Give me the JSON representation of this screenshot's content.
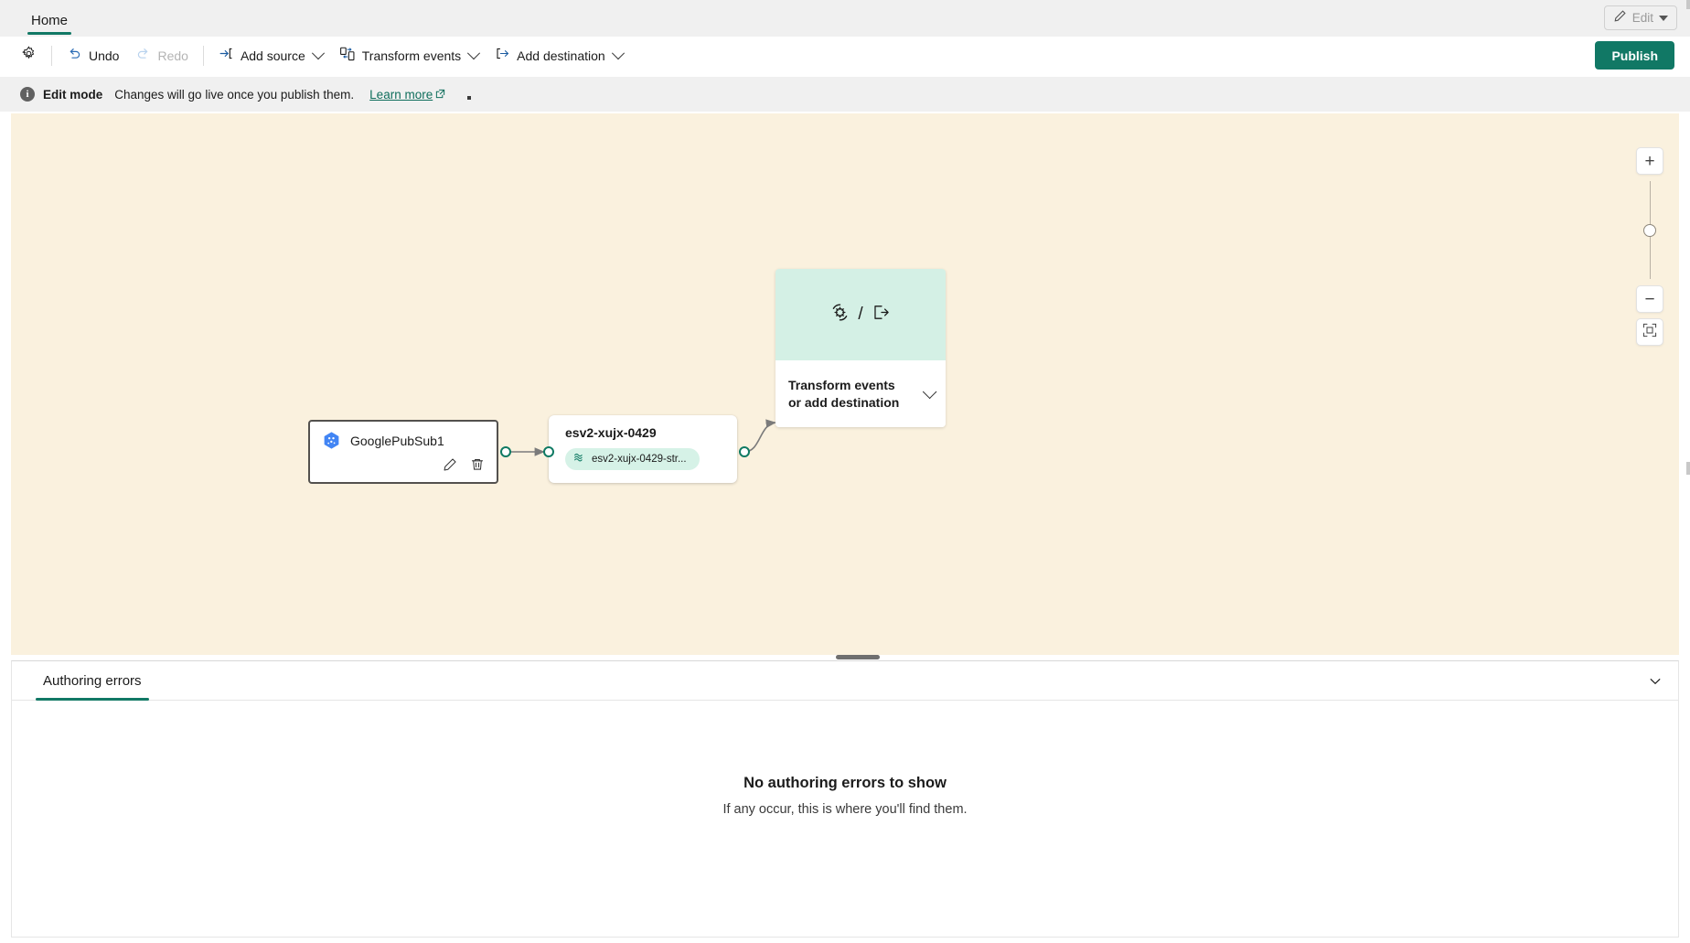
{
  "window": {
    "tab_home": "Home",
    "edit_button": "Edit"
  },
  "toolbar": {
    "settings_icon": "gear-icon",
    "undo": "Undo",
    "redo": "Redo",
    "add_source": "Add source",
    "transform_events": "Transform events",
    "add_destination": "Add destination",
    "publish": "Publish"
  },
  "infobar": {
    "icon": "info-icon",
    "title": "Edit mode",
    "message": "Changes will go live once you publish them.",
    "link": "Learn more"
  },
  "canvas": {
    "background": "#faf1de",
    "source_node": {
      "icon": "google-pubsub-icon",
      "title": "GooglePubSub1",
      "edit_icon": "pencil-icon",
      "delete_icon": "trash-icon"
    },
    "stream_node": {
      "title": "esv2-xujx-0429",
      "chip_icon": "stream-icon",
      "chip_label": "esv2-xujx-0429-str..."
    },
    "placeholder_node": {
      "icon_transform": "transform-icon",
      "separator": "/",
      "icon_destination": "export-icon",
      "label": "Transform events or add destination",
      "chevron": "chevron-down-icon"
    }
  },
  "zoom_controls": {
    "zoom_in": "+",
    "zoom_out": "−",
    "fit_to_screen": "fit-to-screen-icon"
  },
  "bottom_panel": {
    "tabs": [
      {
        "label": "Authoring errors",
        "active": true
      }
    ],
    "collapse_icon": "chevron-down-icon",
    "empty_title": "No authoring errors to show",
    "empty_subtitle": "If any occur, this is where you'll find them."
  },
  "colors": {
    "accent_green": "#117865",
    "canvas_bg": "#faf1de",
    "chip_bg": "#d6f2e7",
    "placeholder_top": "#d4f0e5"
  }
}
